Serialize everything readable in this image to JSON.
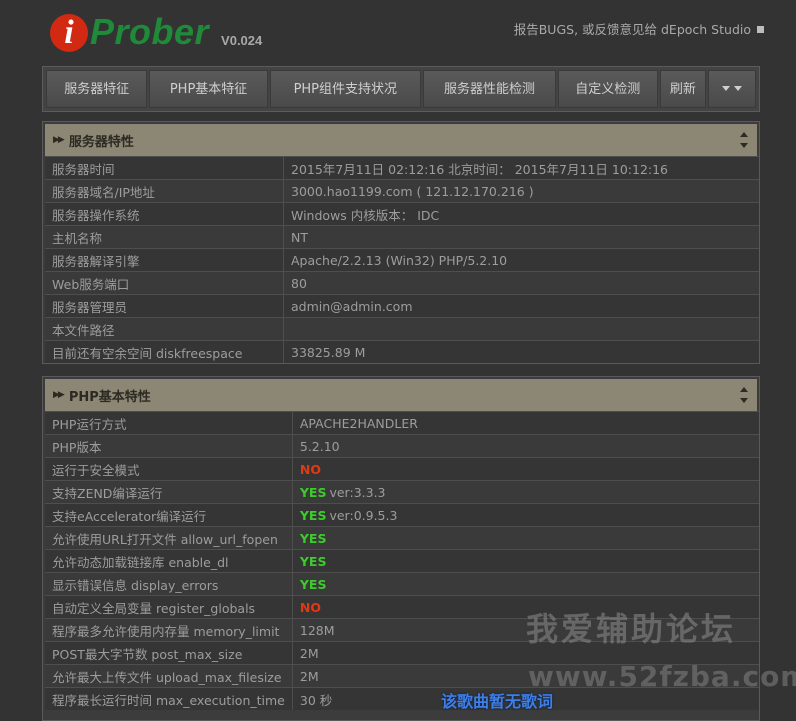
{
  "header": {
    "logo_i": "i",
    "logo_text": "Prober",
    "version": "V0.024",
    "feedback": "报告BUGS, 或反馈意见给 dEpoch Studio"
  },
  "nav": {
    "items": [
      "服务器特征",
      "PHP基本特征",
      "PHP组件支持状况",
      "服务器性能检测",
      "自定义检测",
      "刷新"
    ]
  },
  "server_panel": {
    "title": "服务器特性",
    "rows": [
      {
        "key": "服务器时间",
        "value": "2015年7月11日 02:12:16  北京时间：  2015年7月11日 10:12:16"
      },
      {
        "key": "服务器域名/IP地址",
        "value": "3000.hao1199.com ( 121.12.170.216 )"
      },
      {
        "key": "服务器操作系统",
        "value": "Windows  内核版本：  IDC"
      },
      {
        "key": "主机名称",
        "value": "NT"
      },
      {
        "key": "服务器解译引擎",
        "value": "Apache/2.2.13 (Win32) PHP/5.2.10"
      },
      {
        "key": "Web服务端口",
        "value": "80"
      },
      {
        "key": "服务器管理员",
        "value": "admin@admin.com"
      },
      {
        "key": "本文件路径",
        "value": ""
      },
      {
        "key": "目前还有空余空间 diskfreespace",
        "value": "33825.89 M"
      }
    ]
  },
  "php_panel": {
    "title": "PHP基本特性",
    "rows": [
      {
        "key": "PHP运行方式",
        "value": "APACHE2HANDLER",
        "extra": ""
      },
      {
        "key": "PHP版本",
        "value": "5.2.10",
        "extra": ""
      },
      {
        "key": "运行于安全模式",
        "value": "NO",
        "extra": ""
      },
      {
        "key": "支持ZEND编译运行",
        "value": "YES",
        "extra": "ver:3.3.3"
      },
      {
        "key": "支持eAccelerator编译运行",
        "value": "YES",
        "extra": "ver:0.9.5.3"
      },
      {
        "key": "允许使用URL打开文件 allow_url_fopen",
        "value": "YES",
        "extra": ""
      },
      {
        "key": "允许动态加载链接库 enable_dl",
        "value": "YES",
        "extra": ""
      },
      {
        "key": "显示错误信息 display_errors",
        "value": "YES",
        "extra": ""
      },
      {
        "key": "自动定义全局变量 register_globals",
        "value": "NO",
        "extra": ""
      },
      {
        "key": "程序最多允许使用内存量 memory_limit",
        "value": "128M",
        "extra": ""
      },
      {
        "key": "POST最大字节数 post_max_size",
        "value": "2M",
        "extra": ""
      },
      {
        "key": "允许最大上传文件 upload_max_filesize",
        "value": "2M",
        "extra": ""
      },
      {
        "key": "程序最长运行时间 max_execution_time",
        "value": "30 秒",
        "extra": ""
      }
    ]
  },
  "overlay": {
    "watermark_title": "我爱辅助论坛",
    "watermark_url": "www.52fzba.com",
    "lyric": "该歌曲暂无歌词"
  },
  "colors": {
    "yes": "#3ccc2c",
    "no": "#e03a14",
    "panel_header": "#8c8675",
    "logo_red": "#d22a12",
    "logo_green": "#1f8a3a"
  }
}
